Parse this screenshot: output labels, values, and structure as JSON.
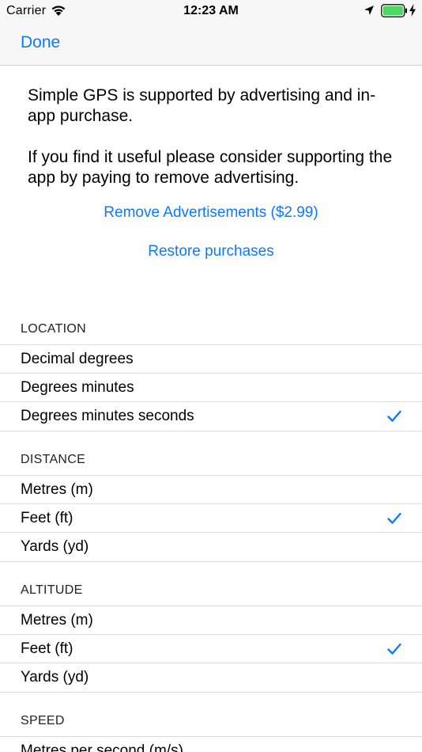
{
  "status_bar": {
    "carrier": "Carrier",
    "time": "12:23 AM",
    "icons": [
      "wifi-icon",
      "location-arrow-icon",
      "battery-icon",
      "charging-bolt-icon"
    ],
    "battery_color": "#4cd964"
  },
  "nav": {
    "done_label": "Done"
  },
  "intro": {
    "paragraph1": "Simple GPS is supported by advertising and in-app purchase.",
    "paragraph2": "If you find it useful please consider supporting the app by paying to remove advertising."
  },
  "purchase": {
    "remove_ads_label": "Remove Advertisements ($2.99)",
    "restore_label": "Restore purchases"
  },
  "accent_color": "#0a7aff",
  "sections": {
    "location": {
      "header": "LOCATION",
      "options": [
        {
          "label": "Decimal degrees",
          "selected": false
        },
        {
          "label": "Degrees minutes",
          "selected": false
        },
        {
          "label": "Degrees minutes seconds",
          "selected": true
        }
      ]
    },
    "distance": {
      "header": "DISTANCE",
      "options": [
        {
          "label": "Metres (m)",
          "selected": false
        },
        {
          "label": "Feet (ft)",
          "selected": true
        },
        {
          "label": "Yards (yd)",
          "selected": false
        }
      ]
    },
    "altitude": {
      "header": "ALTITUDE",
      "options": [
        {
          "label": "Metres (m)",
          "selected": false
        },
        {
          "label": "Feet (ft)",
          "selected": true
        },
        {
          "label": "Yards (yd)",
          "selected": false
        }
      ]
    },
    "speed": {
      "header": "SPEED",
      "options": [
        {
          "label": "Metres per second (m/s)",
          "selected": false
        }
      ]
    }
  }
}
